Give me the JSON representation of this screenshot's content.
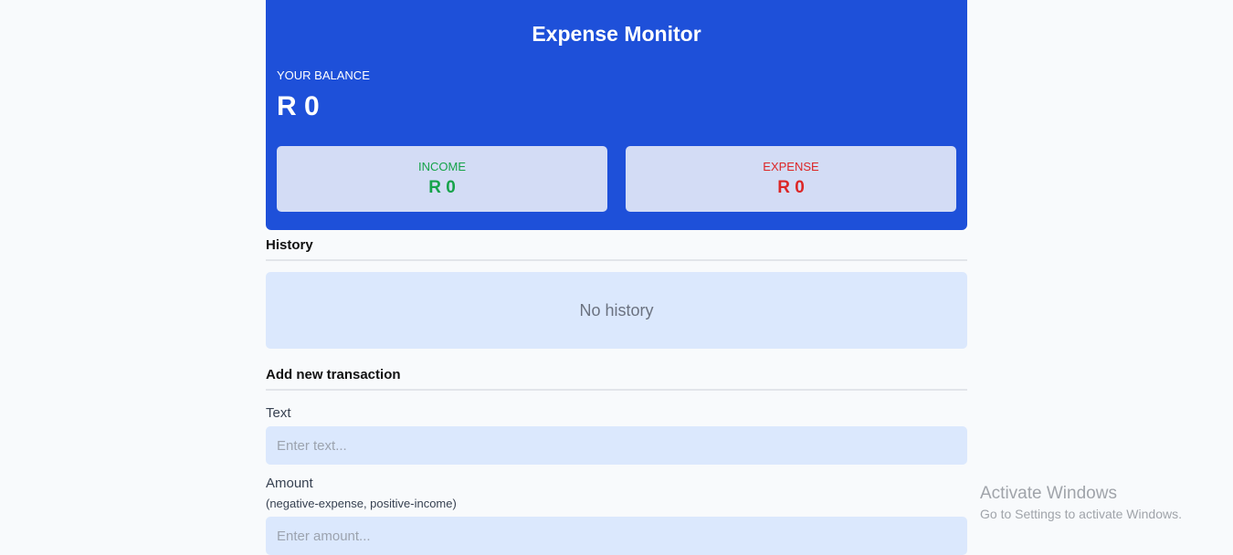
{
  "header": {
    "title": "Expense Monitor",
    "balance_label": "YOUR BALANCE",
    "balance": "R 0",
    "income_label": "INCOME",
    "income": "R 0",
    "expense_label": "EXPENSE",
    "expense": "R 0"
  },
  "history": {
    "title": "History",
    "empty": "No history"
  },
  "form": {
    "title": "Add new transaction",
    "text_label": "Text",
    "text_placeholder": "Enter text...",
    "amount_label": "Amount",
    "amount_hint": "(negative-expense, positive-income)",
    "amount_placeholder": "Enter amount..."
  },
  "watermark": {
    "title": "Activate Windows",
    "sub": "Go to Settings to activate Windows."
  }
}
